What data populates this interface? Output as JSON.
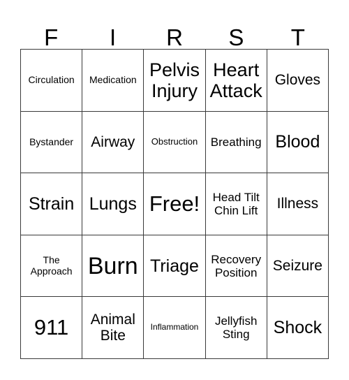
{
  "card": {
    "header_letters": [
      "F",
      "I",
      "R",
      "S",
      "T"
    ],
    "columns": 5,
    "rows": 5,
    "border_color": "#3a3a3a",
    "background_color": "#ffffff",
    "text_color": "#000000",
    "free_space_label": "Free!",
    "cells": [
      {
        "label": "Circulation",
        "size": "fs-s"
      },
      {
        "label": "Medication",
        "size": "fs-s"
      },
      {
        "label": "Pelvis\nInjury",
        "size": "fs-2xl"
      },
      {
        "label": "Heart\nAttack",
        "size": "fs-2xl"
      },
      {
        "label": "Gloves",
        "size": "fs-l"
      },
      {
        "label": "Bystander",
        "size": "fs-s"
      },
      {
        "label": "Airway",
        "size": "fs-l"
      },
      {
        "label": "Obstruction",
        "size": "fs-xs"
      },
      {
        "label": "Breathing",
        "size": "fs-m"
      },
      {
        "label": "Blood",
        "size": "fs-xl"
      },
      {
        "label": "Strain",
        "size": "fs-xl"
      },
      {
        "label": "Lungs",
        "size": "fs-xl"
      },
      {
        "label": "Free!",
        "size": "fs-3xl"
      },
      {
        "label": "Head Tilt\nChin Lift",
        "size": "fs-m"
      },
      {
        "label": "Illness",
        "size": "fs-l"
      },
      {
        "label": "The\nApproach",
        "size": "fs-s"
      },
      {
        "label": "Burn",
        "size": "fs-4xl"
      },
      {
        "label": "Triage",
        "size": "fs-xl"
      },
      {
        "label": "Recovery\nPosition",
        "size": "fs-m"
      },
      {
        "label": "Seizure",
        "size": "fs-l"
      },
      {
        "label": "911",
        "size": "fs-3xl"
      },
      {
        "label": "Animal\nBite",
        "size": "fs-l"
      },
      {
        "label": "Inflammation",
        "size": "fs-xxs"
      },
      {
        "label": "Jellyfish\nSting",
        "size": "fs-m"
      },
      {
        "label": "Shock",
        "size": "fs-xl"
      }
    ]
  }
}
